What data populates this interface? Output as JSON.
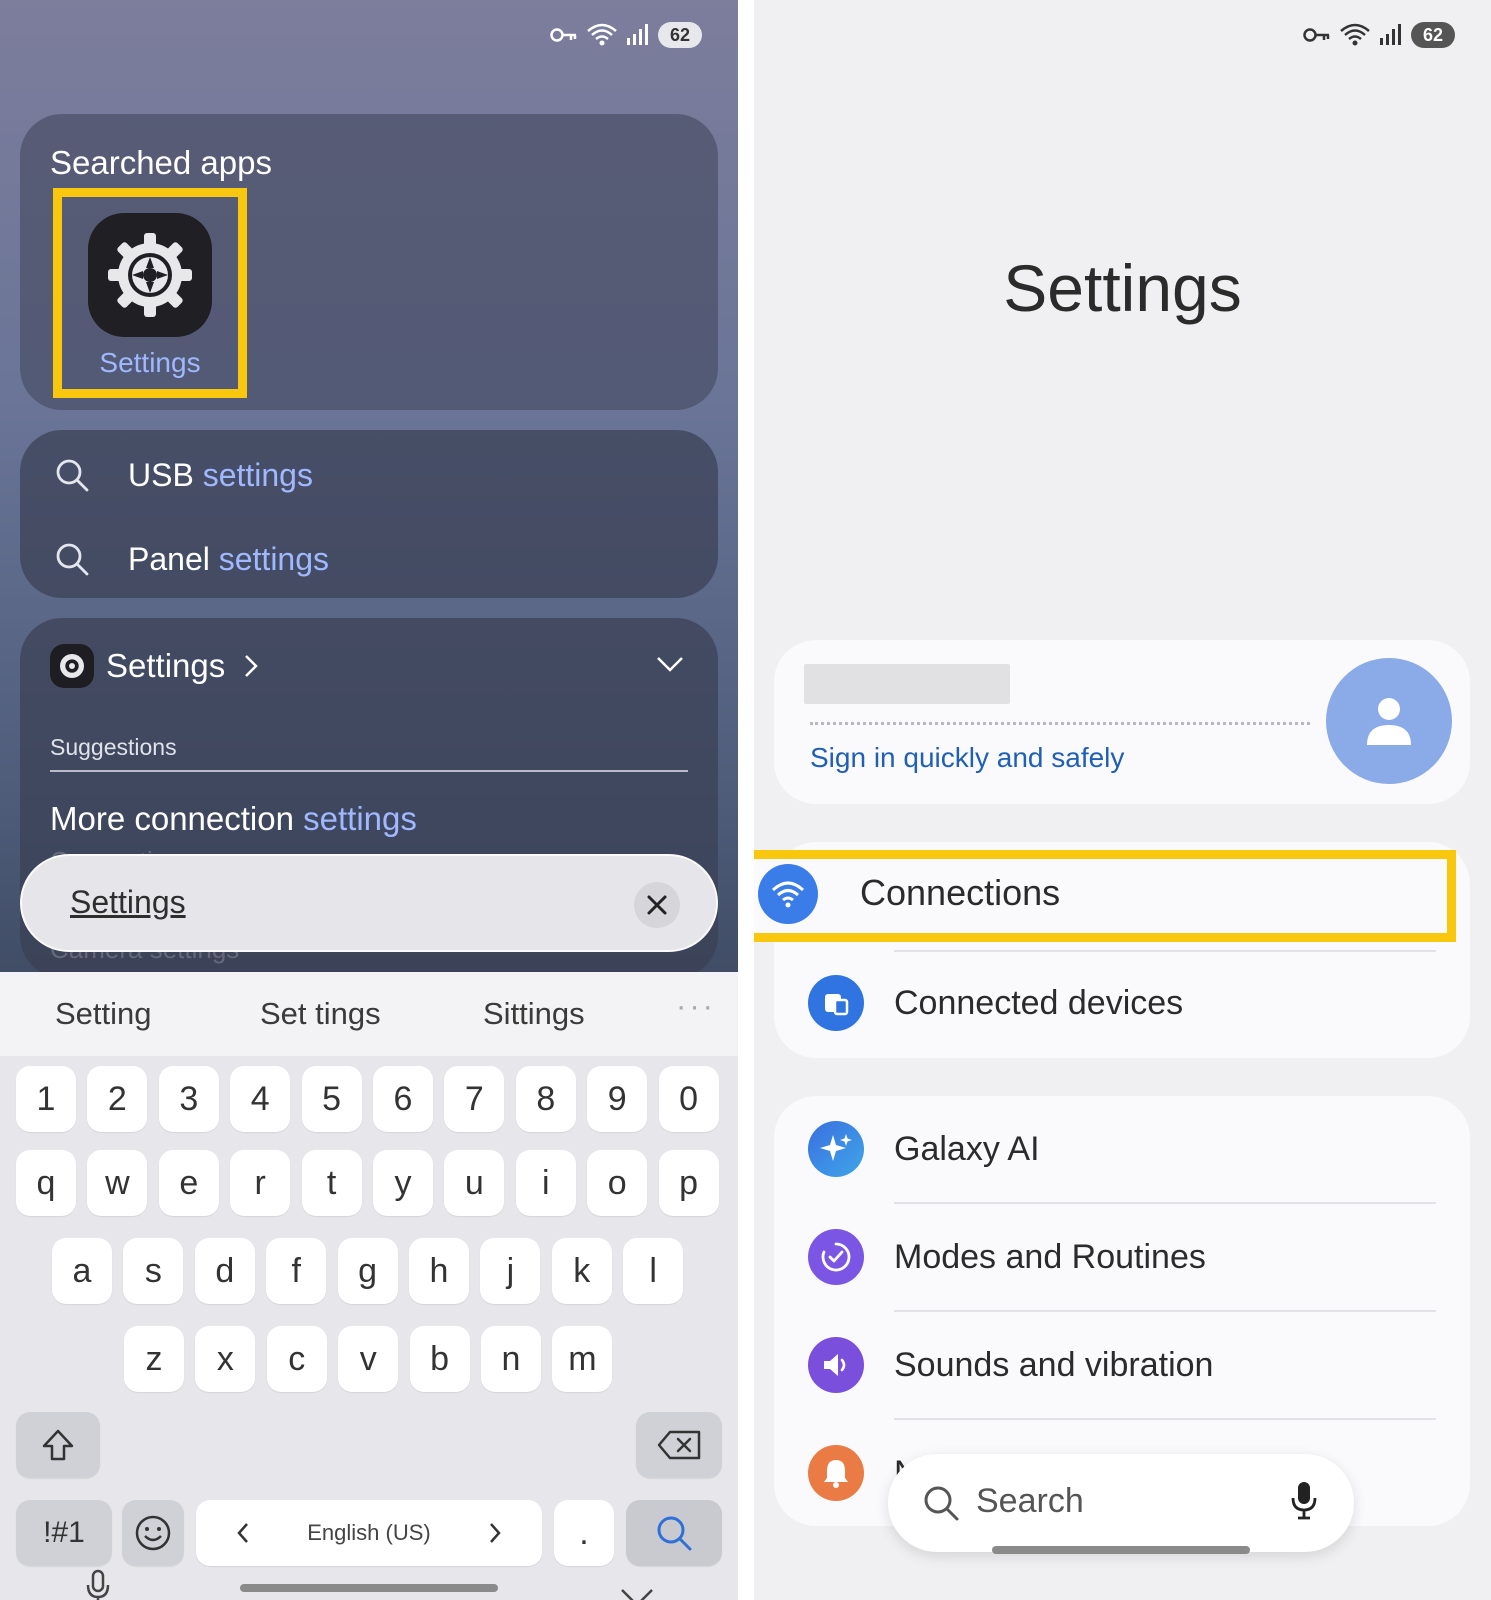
{
  "left": {
    "status": {
      "battery": "62"
    },
    "searched_apps": {
      "title": "Searched apps",
      "app_label": "Settings"
    },
    "suggestions": [
      {
        "prefix": "USB ",
        "highlight": "settings"
      },
      {
        "prefix": "Panel ",
        "highlight": "settings"
      }
    ],
    "settings_section": {
      "title": "Settings",
      "suggestions_label": "Suggestions",
      "result_prefix": "More connection ",
      "result_highlight": "settings",
      "ghost_1": "Connections",
      "ghost_2": "Camera settings"
    },
    "search_bar": {
      "value": "Settings"
    },
    "keyboard": {
      "predictions": [
        "Setting",
        "Set tings",
        "Sittings"
      ],
      "more": "···",
      "row_numbers": [
        "1",
        "2",
        "3",
        "4",
        "5",
        "6",
        "7",
        "8",
        "9",
        "0"
      ],
      "row_q": [
        "q",
        "w",
        "e",
        "r",
        "t",
        "y",
        "u",
        "i",
        "o",
        "p"
      ],
      "row_a": [
        "a",
        "s",
        "d",
        "f",
        "g",
        "h",
        "j",
        "k",
        "l"
      ],
      "row_z": [
        "z",
        "x",
        "c",
        "v",
        "b",
        "n",
        "m"
      ],
      "sym_label": "!#1",
      "language": "English (US)",
      "period": "."
    }
  },
  "right": {
    "status": {
      "battery": "62"
    },
    "title": "Settings",
    "account": {
      "sign_in": "Sign in quickly and safely"
    },
    "items": [
      {
        "label": "Connections",
        "color": "#3a7de8",
        "icon": "wifi-icon"
      },
      {
        "label": "Connected devices",
        "color": "#2f74e0",
        "icon": "devices-icon"
      },
      {
        "label": "Galaxy AI",
        "color": "#3f6fe0",
        "icon": "sparkle-icon"
      },
      {
        "label": "Modes and Routines",
        "color": "#7b55e3",
        "icon": "routine-icon"
      },
      {
        "label": "Sounds and vibration",
        "color": "#7a4fdc",
        "icon": "volume-icon"
      },
      {
        "label": "N",
        "color": "#ea7b45",
        "icon": "bell-icon"
      }
    ],
    "search": {
      "placeholder": "Search"
    }
  }
}
